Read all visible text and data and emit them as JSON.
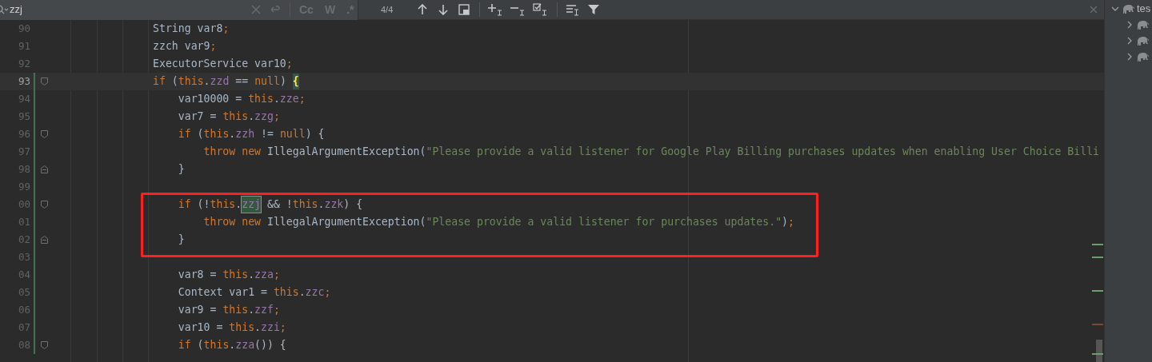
{
  "search_bar": {
    "query": "zzj",
    "options": [
      {
        "label": "Cc",
        "selected": false
      },
      {
        "label": "W",
        "selected": false
      },
      {
        "label": ".*",
        "selected": false
      }
    ],
    "match_count": "4/4"
  },
  "editor": {
    "lines": [
      {
        "number": "90",
        "current": false,
        "changed": false,
        "tokens": [
          {
            "kind": "plain",
            "text": "                String var8"
          },
          {
            "kind": "punct",
            "text": ";"
          }
        ]
      },
      {
        "number": "91",
        "current": false,
        "changed": false,
        "tokens": [
          {
            "kind": "plain",
            "text": "                zzch var9"
          },
          {
            "kind": "punct",
            "text": ";"
          }
        ]
      },
      {
        "number": "92",
        "current": false,
        "changed": false,
        "tokens": [
          {
            "kind": "plain",
            "text": "                ExecutorService var10"
          },
          {
            "kind": "punct",
            "text": ";"
          }
        ]
      },
      {
        "number": "93",
        "current": true,
        "changed": true,
        "fold_marker": {
          "kind": "start"
        },
        "tokens": [
          {
            "kind": "keyword",
            "text": "                if"
          },
          {
            "kind": "plain",
            "text": " ("
          },
          {
            "kind": "keyword",
            "text": "this"
          },
          {
            "kind": "plain",
            "text": "."
          },
          {
            "kind": "field",
            "text": "zzd"
          },
          {
            "kind": "plain",
            "text": " == "
          },
          {
            "kind": "keyword",
            "text": "null"
          },
          {
            "kind": "plain",
            "text": ") "
          },
          {
            "kind": "brace",
            "text": "{"
          }
        ]
      },
      {
        "number": "94",
        "current": false,
        "changed": true,
        "tokens": [
          {
            "kind": "plain",
            "text": "                    var10000 = "
          },
          {
            "kind": "keyword",
            "text": "this"
          },
          {
            "kind": "plain",
            "text": "."
          },
          {
            "kind": "field",
            "text": "zze"
          },
          {
            "kind": "punct",
            "text": ";"
          }
        ]
      },
      {
        "number": "95",
        "current": false,
        "changed": true,
        "tokens": [
          {
            "kind": "plain",
            "text": "                    var7 = "
          },
          {
            "kind": "keyword",
            "text": "this"
          },
          {
            "kind": "plain",
            "text": "."
          },
          {
            "kind": "field",
            "text": "zzg"
          },
          {
            "kind": "punct",
            "text": ";"
          }
        ]
      },
      {
        "number": "96",
        "current": false,
        "changed": true,
        "fold_marker": {
          "kind": "start"
        },
        "tokens": [
          {
            "kind": "keyword",
            "text": "                    if"
          },
          {
            "kind": "plain",
            "text": " ("
          },
          {
            "kind": "keyword",
            "text": "this"
          },
          {
            "kind": "plain",
            "text": "."
          },
          {
            "kind": "field",
            "text": "zzh"
          },
          {
            "kind": "plain",
            "text": " != "
          },
          {
            "kind": "keyword",
            "text": "null"
          },
          {
            "kind": "plain",
            "text": ") {"
          }
        ]
      },
      {
        "number": "97",
        "current": false,
        "changed": true,
        "tokens": [
          {
            "kind": "keyword",
            "text": "                        throw new"
          },
          {
            "kind": "plain",
            "text": " IllegalArgumentException("
          },
          {
            "kind": "string",
            "text": "\"Please provide a valid listener for Google Play Billing purchases updates when enabling User Choice Billi"
          }
        ]
      },
      {
        "number": "98",
        "current": false,
        "changed": true,
        "fold_marker": {
          "kind": "end"
        },
        "tokens": [
          {
            "kind": "plain",
            "text": "                    }"
          }
        ]
      },
      {
        "number": "99",
        "current": false,
        "changed": true
      },
      {
        "number": "00",
        "current": false,
        "changed": true,
        "fold_marker": {
          "kind": "start"
        },
        "tokens": [
          {
            "kind": "keyword",
            "text": "                    if"
          },
          {
            "kind": "plain",
            "text": " (!"
          },
          {
            "kind": "keyword",
            "text": "this"
          },
          {
            "kind": "plain",
            "text": "."
          },
          {
            "kind": "match",
            "text": "zzj"
          },
          {
            "kind": "plain",
            "text": " && !"
          },
          {
            "kind": "keyword",
            "text": "this"
          },
          {
            "kind": "plain",
            "text": "."
          },
          {
            "kind": "field",
            "text": "zzk"
          },
          {
            "kind": "plain",
            "text": ") {"
          }
        ]
      },
      {
        "number": "01",
        "current": false,
        "changed": true,
        "tokens": [
          {
            "kind": "keyword",
            "text": "                        throw new"
          },
          {
            "kind": "plain",
            "text": " IllegalArgumentException("
          },
          {
            "kind": "string",
            "text": "\"Please provide a valid listener for purchases updates.\""
          },
          {
            "kind": "plain",
            "text": ")"
          },
          {
            "kind": "punct",
            "text": ";"
          }
        ]
      },
      {
        "number": "02",
        "current": false,
        "changed": true,
        "fold_marker": {
          "kind": "end"
        },
        "tokens": [
          {
            "kind": "plain",
            "text": "                    }"
          }
        ]
      },
      {
        "number": "03",
        "current": false,
        "changed": true
      },
      {
        "number": "04",
        "current": false,
        "changed": true,
        "tokens": [
          {
            "kind": "plain",
            "text": "                    var8 = "
          },
          {
            "kind": "keyword",
            "text": "this"
          },
          {
            "kind": "plain",
            "text": "."
          },
          {
            "kind": "field",
            "text": "zza"
          },
          {
            "kind": "punct",
            "text": ";"
          }
        ]
      },
      {
        "number": "05",
        "current": false,
        "changed": true,
        "tokens": [
          {
            "kind": "plain",
            "text": "                    Context var1 = "
          },
          {
            "kind": "keyword",
            "text": "this"
          },
          {
            "kind": "plain",
            "text": "."
          },
          {
            "kind": "field",
            "text": "zzc"
          },
          {
            "kind": "punct",
            "text": ";"
          }
        ]
      },
      {
        "number": "06",
        "current": false,
        "changed": true,
        "tokens": [
          {
            "kind": "plain",
            "text": "                    var9 = "
          },
          {
            "kind": "keyword",
            "text": "this"
          },
          {
            "kind": "plain",
            "text": "."
          },
          {
            "kind": "field",
            "text": "zzf"
          },
          {
            "kind": "punct",
            "text": ";"
          }
        ]
      },
      {
        "number": "07",
        "current": false,
        "changed": true,
        "tokens": [
          {
            "kind": "plain",
            "text": "                    var10 = "
          },
          {
            "kind": "keyword",
            "text": "this"
          },
          {
            "kind": "plain",
            "text": "."
          },
          {
            "kind": "field",
            "text": "zzi"
          },
          {
            "kind": "punct",
            "text": ";"
          }
        ]
      },
      {
        "number": "08",
        "current": false,
        "changed": true,
        "fold_marker": {
          "kind": "start"
        },
        "tokens": [
          {
            "kind": "keyword",
            "text": "                    if"
          },
          {
            "kind": "plain",
            "text": " ("
          },
          {
            "kind": "keyword",
            "text": "this"
          },
          {
            "kind": "plain",
            "text": "."
          },
          {
            "kind": "field",
            "text": "zza"
          },
          {
            "kind": "plain",
            "text": "()) {"
          }
        ]
      }
    ]
  },
  "project_tree": [
    {
      "label": "tes",
      "expanded": true,
      "children": [
        {
          "expanded": false
        },
        {
          "expanded": false
        },
        {
          "expanded": false
        }
      ]
    }
  ]
}
